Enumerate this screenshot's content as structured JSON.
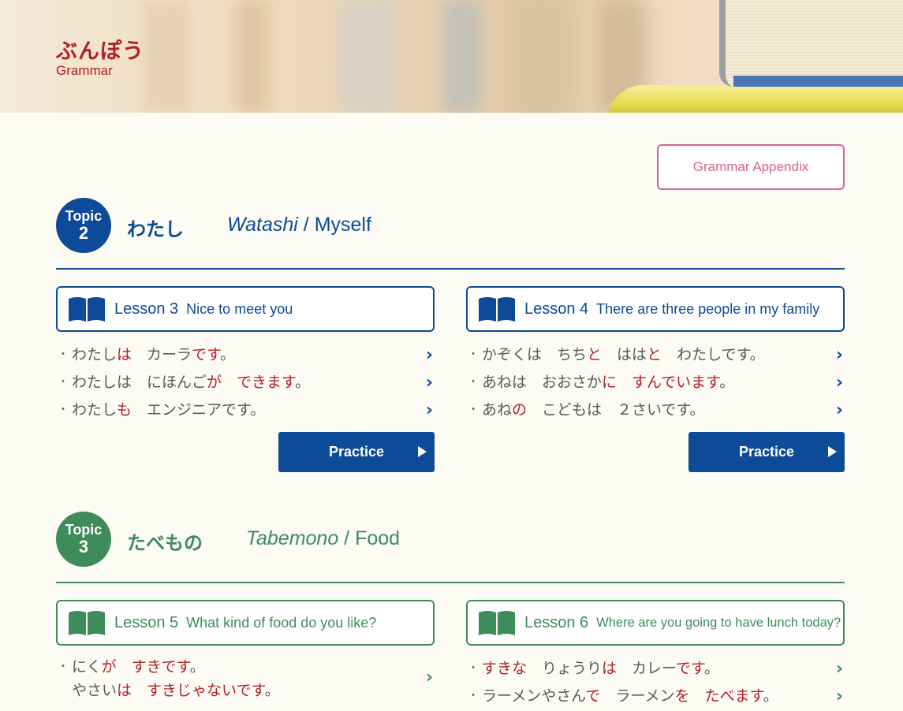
{
  "header": {
    "title": "ぶんぽう",
    "subtitle": "Grammar"
  },
  "appendix_button": "Grammar Appendix",
  "topics": [
    {
      "badge_label": "Topic",
      "number": "2",
      "title_jp": "わたし",
      "title_romaji": "Watashi",
      "title_en": "Myself",
      "lessons": [
        {
          "number_label": "Lesson 3",
          "title": "Nice to meet you",
          "items": [
            [
              {
                "t": "わたしは",
                "r": false
              },
              {
                "t": "は",
                "r": true
              },
              {
                "t": "　カーラです。",
                "r": false
              }
            ],
            [
              {
                "t": "わたしは",
                "r": false
              },
              {
                "t": "　にほんごが",
                "r": false
              },
              {
                "t": "　できます。",
                "r": true
              }
            ],
            [
              {
                "t": "わたしも",
                "r": false
              },
              {
                "t": "　エンジニアです。",
                "r": false
              }
            ]
          ],
          "practice_label": "Practice"
        },
        {
          "number_label": "Lesson 4",
          "title": "There are three people in my family",
          "items": [
            [
              {
                "t": "かぞくは　ちちと　ははと　わたしです。",
                "r": false
              }
            ],
            [
              {
                "t": "あねは　おおさかに　すんでいます。",
                "r": false
              }
            ],
            [
              {
                "t": "あねの　こどもは　２さいです。",
                "r": false
              }
            ]
          ],
          "practice_label": "Practice"
        }
      ]
    },
    {
      "badge_label": "Topic",
      "number": "3",
      "title_jp": "たべもの",
      "title_romaji": "Tabemono",
      "title_en": "Food",
      "lessons": [
        {
          "number_label": "Lesson 5",
          "title": "What kind of food do you like?",
          "items": [
            [
              {
                "t": "にくが　すきです。",
                "r": false
              }
            ],
            [
              {
                "t": "やさいは　すきじゃないです。",
                "r": false
              }
            ]
          ]
        },
        {
          "number_label": "Lesson 6",
          "title": "Where are you going to have lunch today?",
          "items": [
            [
              {
                "t": "すきな　りょうりは　カレーです。",
                "r": false
              }
            ],
            [
              {
                "t": "ラーメンやさんで　ラーメンを　たべます。",
                "r": false
              }
            ]
          ]
        }
      ]
    }
  ],
  "colors": {
    "topic2": "#0d4a97",
    "topic3": "#3d8c5a",
    "highlight": "#b32025",
    "appendix": "#d9628a"
  },
  "icons": {
    "lesson": "open-book-icon",
    "item": "chevron-right-icon",
    "practice": "play-triangle-icon"
  }
}
